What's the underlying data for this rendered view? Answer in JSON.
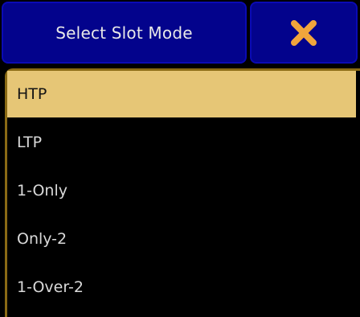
{
  "dialog": {
    "title": "Select Slot Mode",
    "close_icon": "close-x-icon"
  },
  "options": {
    "selected": "HTP",
    "items": [
      {
        "label": "HTP"
      },
      {
        "label": "LTP"
      },
      {
        "label": "1-Only"
      },
      {
        "label": "Only-2"
      },
      {
        "label": "1-Over-2"
      }
    ]
  },
  "colors": {
    "header_bg": "#03038c",
    "header_border": "#0a0ab4",
    "close_icon": "#f0a53c",
    "selected_bg": "#e6c676",
    "panel_border": "#8a6a14",
    "text": "#d9d9d9"
  }
}
